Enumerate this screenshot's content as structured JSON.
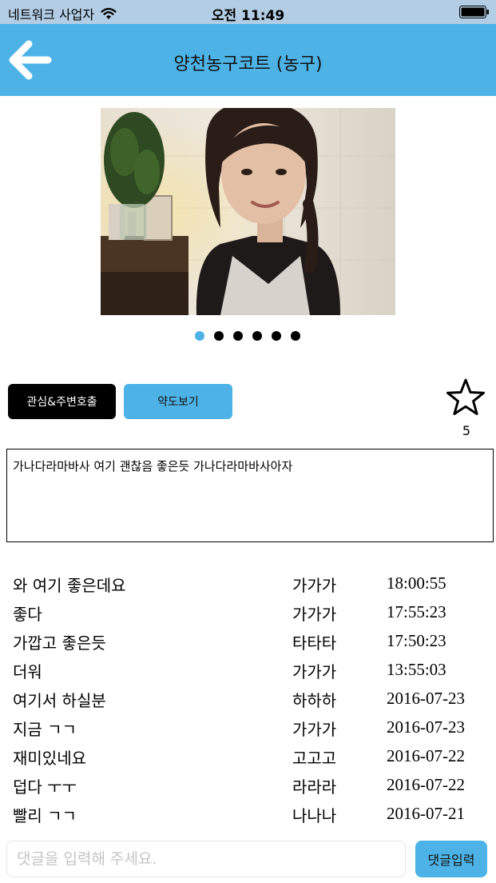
{
  "status_bar": {
    "carrier": "네트워크 사업자",
    "time": "오전 11:49"
  },
  "nav": {
    "title": "양천농구코트 (농구)"
  },
  "pager": {
    "count": 6,
    "active_index": 0
  },
  "buttons": {
    "interest": "관심&주변호출",
    "map": "약도보기"
  },
  "rating": {
    "star_count": "5"
  },
  "description": "가나다라마바사 여기 괜찮음 좋은듯 가나다라마바사아자",
  "comments": [
    {
      "text": "와 여기 좋은데요",
      "user": "가가가",
      "time": "18:00:55"
    },
    {
      "text": "좋다",
      "user": "가가가",
      "time": "17:55:23"
    },
    {
      "text": "가깝고 좋은듯",
      "user": "타타타",
      "time": "17:50:23"
    },
    {
      "text": "더워",
      "user": "가가가",
      "time": "13:55:03"
    },
    {
      "text": "여기서 하실분",
      "user": "하하하",
      "time": "2016-07-23"
    },
    {
      "text": "지금 ㄱㄱ",
      "user": "가가가",
      "time": "2016-07-23"
    },
    {
      "text": "재미있네요",
      "user": "고고고",
      "time": "2016-07-22"
    },
    {
      "text": "덥다 ㅜㅜ",
      "user": "라라라",
      "time": "2016-07-22"
    },
    {
      "text": "빨리 ㄱㄱ",
      "user": "나나나",
      "time": "2016-07-21"
    }
  ],
  "comment_input": {
    "placeholder": "댓글을 입력해 주세요.",
    "value": ""
  },
  "submit_label": "댓글입력",
  "colors": {
    "accent": "#4db3e6",
    "status_bar": "#b3cde4"
  }
}
